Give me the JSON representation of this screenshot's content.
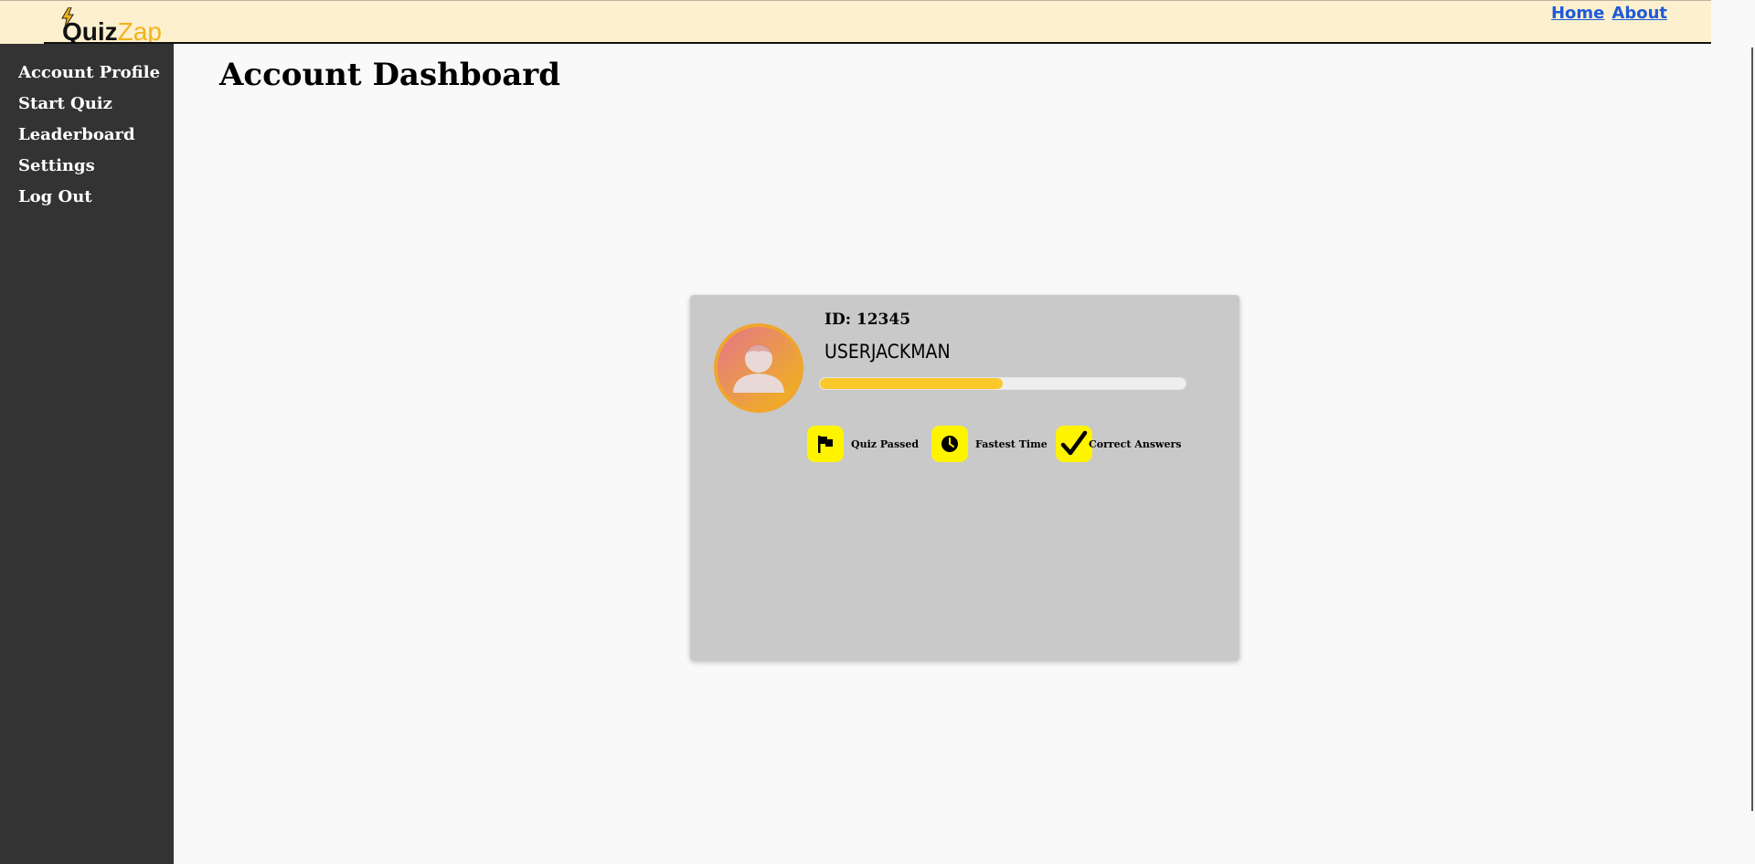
{
  "header": {
    "logo_part1": "Quiz",
    "logo_part2": "Zap",
    "links": [
      "Home",
      "About"
    ]
  },
  "sidebar": {
    "items": [
      {
        "label": "Account Profile"
      },
      {
        "label": "Start Quiz"
      },
      {
        "label": "Leaderboard"
      },
      {
        "label": "Settings"
      },
      {
        "label": "Log Out"
      }
    ]
  },
  "main": {
    "title": "Account Dashboard"
  },
  "profile": {
    "id": "ID: 12345",
    "username": "USERJACKMAN",
    "progress_fraction": 0.5,
    "stats": [
      {
        "label": "Quiz Passed",
        "icon": "flag-icon"
      },
      {
        "label": "Fastest Time",
        "icon": "clock-icon"
      },
      {
        "label": "Correct Answers",
        "icon": "checkmark-icon"
      }
    ]
  },
  "colors": {
    "topbar_bg": "#fcf0ce",
    "sidebar_bg": "#333333",
    "accent_yellow": "#fbc82b",
    "stat_icon_bg": "#fff400",
    "link": "#1f5ad7"
  }
}
